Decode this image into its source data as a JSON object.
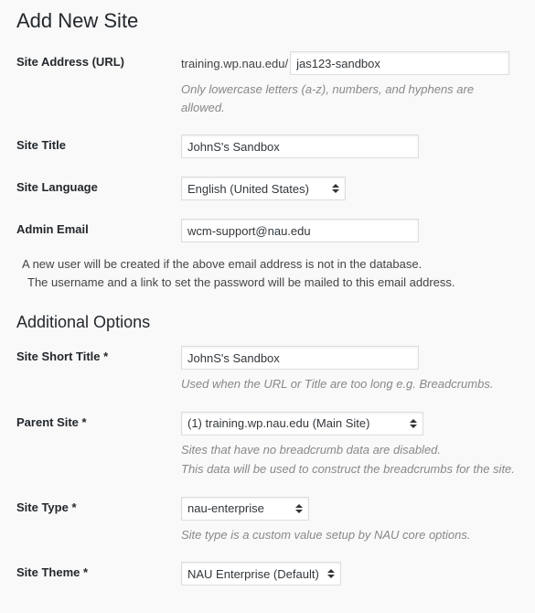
{
  "page": {
    "title": "Add New Site"
  },
  "fields": {
    "site_address": {
      "label": "Site Address (URL)",
      "prefix": "training.wp.nau.edu/",
      "value": "jas123-sandbox",
      "description": "Only lowercase letters (a-z), numbers, and hyphens are allowed."
    },
    "site_title": {
      "label": "Site Title",
      "value": "JohnS's Sandbox"
    },
    "site_language": {
      "label": "Site Language",
      "value": "English (United States)"
    },
    "admin_email": {
      "label": "Admin Email",
      "value": "wcm-support@nau.edu"
    }
  },
  "notice": {
    "line1": "A new user will be created if the above email address is not in the database.",
    "line2": "The username and a link to set the password will be mailed to this email address."
  },
  "additional": {
    "heading": "Additional Options",
    "short_title": {
      "label": "Site Short Title *",
      "value": "JohnS's Sandbox",
      "description": "Used when the URL or Title are too long e.g. Breadcrumbs."
    },
    "parent_site": {
      "label": "Parent Site *",
      "value": "(1) training.wp.nau.edu (Main Site)",
      "description1": "Sites that have no breadcrumb data are disabled.",
      "description2": "This data will be used to construct the breadcrumbs for the site."
    },
    "site_type": {
      "label": "Site Type *",
      "value": "nau-enterprise",
      "description": "Site type is a custom value setup by NAU core options."
    },
    "site_theme": {
      "label": "Site Theme *",
      "value": "NAU Enterprise (Default)"
    }
  }
}
